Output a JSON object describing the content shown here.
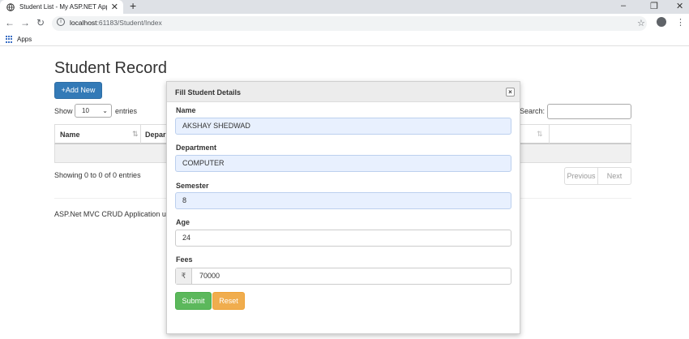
{
  "browser": {
    "tab_title": "Student List - My ASP.NET Applic",
    "tab_close": "✕",
    "new_tab": "+",
    "url_host": "localhost",
    "url_path": ":61183/Student/Index",
    "bookmarks_apps": "Apps"
  },
  "page": {
    "title": "Student Record",
    "add_new": "+Add New",
    "show_label": "Show",
    "entries_value": "10",
    "entries_label": "entries",
    "search_label": "Search:",
    "columns": [
      "Name",
      "Depar"
    ],
    "info": "Showing 0 to 0 of 0 entries",
    "pager_previous": "Previous",
    "pager_next": "Next",
    "footer": "ASP.Net MVC CRUD Application us"
  },
  "modal": {
    "title": "Fill Student Details",
    "close": "×",
    "fields": {
      "name_label": "Name",
      "name_value": "AKSHAY SHEDWAD",
      "department_label": "Department",
      "department_value": "COMPUTER",
      "semester_label": "Semester",
      "semester_value": "8",
      "age_label": "Age",
      "age_value": "24",
      "fees_label": "Fees",
      "fees_currency": "₹",
      "fees_value": "70000"
    },
    "submit": "Submit",
    "reset": "Reset"
  },
  "colors": {
    "primary": "#337ab7",
    "success": "#5cb85c",
    "warning": "#f0ad4e",
    "autofill": "#e8f0fe"
  },
  "icons": [
    "globe-icon",
    "back-arrow-icon",
    "forward-arrow-icon",
    "reload-icon",
    "info-icon",
    "star-icon",
    "profile-icon",
    "kebab-menu-icon",
    "apps-grid-icon",
    "sort-icon",
    "close-icon",
    "rupee-icon"
  ]
}
